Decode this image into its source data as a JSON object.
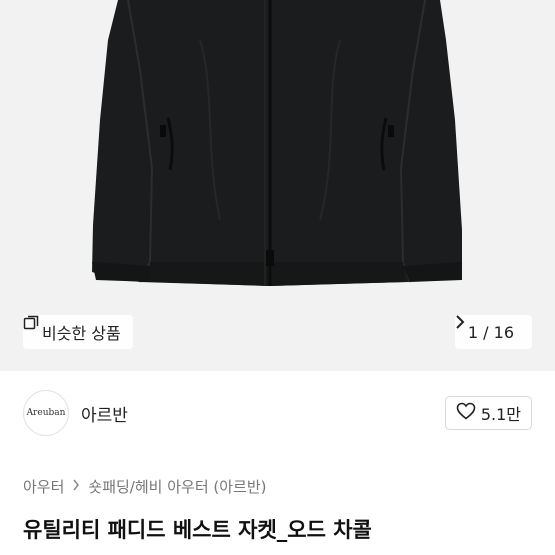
{
  "product_image": {
    "alt": "",
    "bg_color": "#f2f2f2",
    "jacket_color": "#1b1c1d"
  },
  "similar_button": {
    "label": "비슷한 상품",
    "icon": "similar-products-icon"
  },
  "pager": {
    "text": "1 / 16",
    "next_icon": "chevron-right-icon"
  },
  "shop": {
    "logo_text": "Areuban",
    "name": "아르반"
  },
  "like": {
    "count": "5.1만",
    "icon": "heart-outline-icon"
  },
  "breadcrumb": {
    "level1": "아우터",
    "level2": "숏패딩/헤비 아우터 (아르반)"
  },
  "product": {
    "title": "유틸리티 패디드 베스트 자켓_오드 차콜"
  }
}
